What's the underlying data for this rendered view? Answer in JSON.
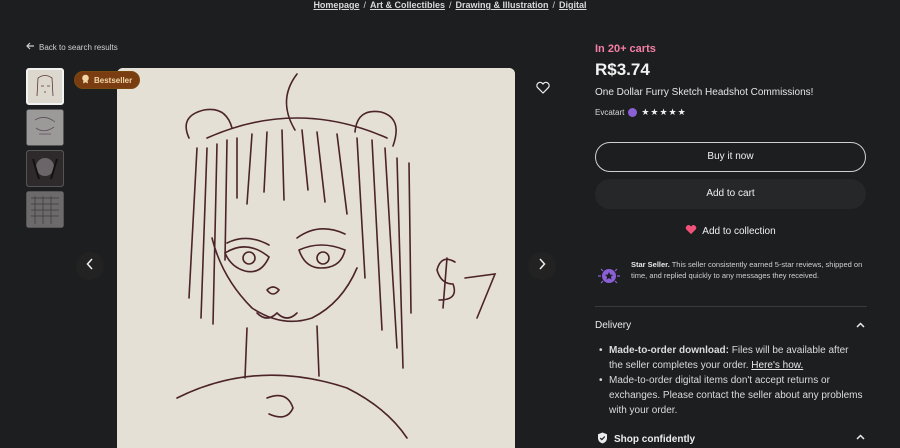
{
  "breadcrumb": [
    "Homepage",
    "Art & Collectibles",
    "Drawing & Illustration",
    "Digital"
  ],
  "back_link": "Back to search results",
  "badge": "Bestseller",
  "product": {
    "in_carts": "In 20+ carts",
    "price": "R$3.74",
    "title": "One Dollar Furry Sketch Headshot Commissions!",
    "shop_name": "Evcatart",
    "rating_stars": "★★★★★"
  },
  "buttons": {
    "buy_now": "Buy it now",
    "add_to_cart": "Add to cart",
    "add_to_collection": "Add to collection"
  },
  "star_seller": {
    "label": "Star Seller.",
    "text": " This seller consistently earned 5-star reviews, shipped on time, and replied quickly to any messages they received."
  },
  "delivery": {
    "heading": "Delivery",
    "item1_bold": "Made-to-order download:",
    "item1_text": " Files will be available after the seller completes your order. ",
    "item1_link": "Here's how.",
    "item2": "Made-to-order digital items don't accept returns or exchanges. Please contact the seller about any problems with your order."
  },
  "shop_confidently": "Shop confidently",
  "colors": {
    "accent_pink": "#f67fa6",
    "star_purple": "#8b5fd6",
    "heart": "#f2527a"
  }
}
